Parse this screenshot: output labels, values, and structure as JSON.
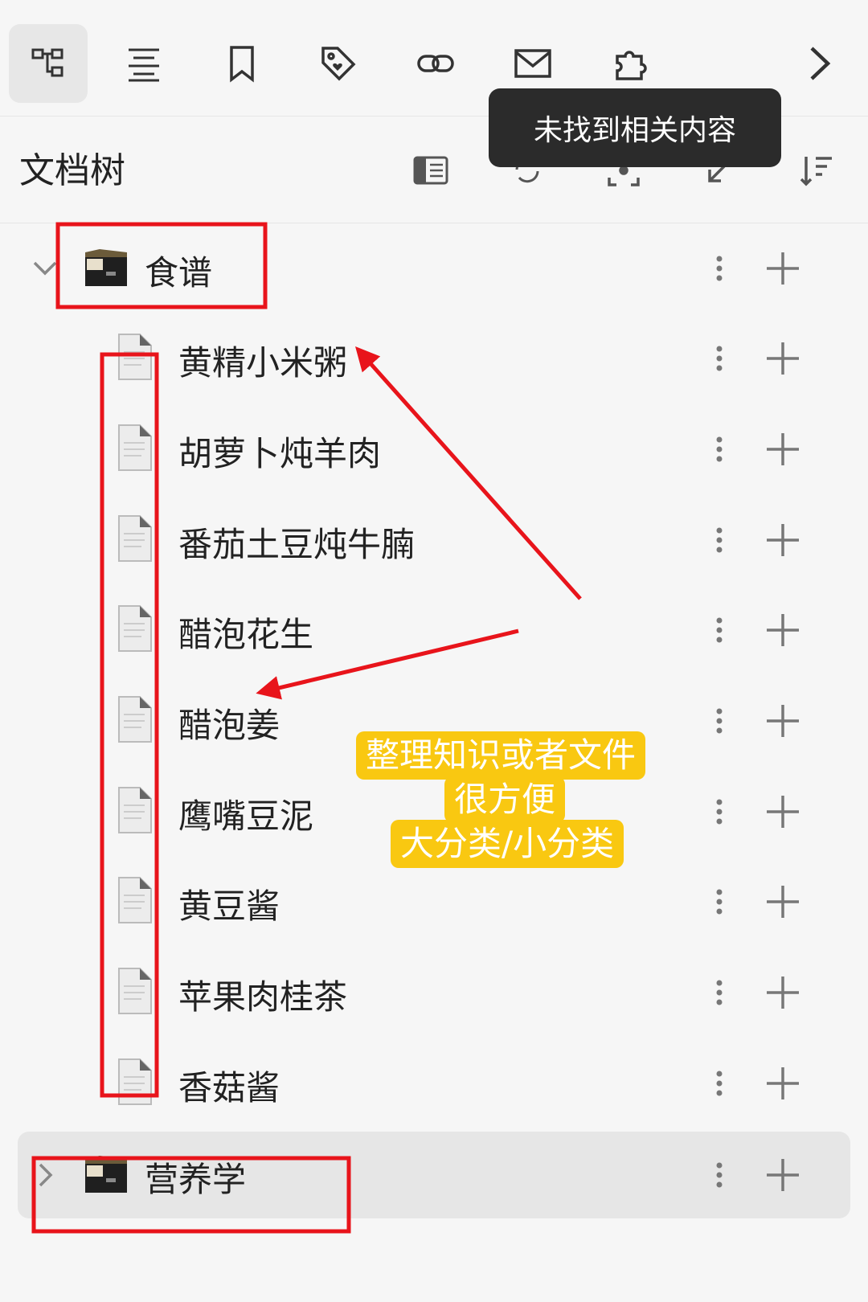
{
  "toolbar": {
    "buttons": [
      {
        "icon": "file-tree-icon",
        "active": true
      },
      {
        "icon": "outline-icon"
      },
      {
        "icon": "bookmark-icon"
      },
      {
        "icon": "tag-icon"
      },
      {
        "icon": "backlink-icon"
      },
      {
        "icon": "mail-icon"
      },
      {
        "icon": "puzzle-icon"
      },
      {
        "icon": "chevron-right-icon"
      }
    ]
  },
  "tooltip": {
    "text": "未找到相关内容"
  },
  "dock": {
    "title": "文档树",
    "actions": [
      "sidebar-toggle-icon",
      "refresh-icon",
      "focus-icon",
      "collapse-icon",
      "sort-icon"
    ]
  },
  "tree": {
    "notebooks": [
      {
        "name": "食谱",
        "expanded": true,
        "docs": [
          "黄精小米粥",
          "胡萝卜炖羊肉",
          "番茄土豆炖牛腩",
          "醋泡花生",
          "醋泡姜",
          "鹰嘴豆泥",
          "黄豆酱",
          "苹果肉桂茶",
          "香菇酱"
        ]
      },
      {
        "name": "营养学",
        "expanded": false,
        "docs": []
      }
    ]
  },
  "annotation": {
    "line1": "整理知识或者文件",
    "line2": "很方便",
    "line3": "大分类/小分类",
    "highlight_color": "#f9c811",
    "marker_color": "#e8141b"
  }
}
